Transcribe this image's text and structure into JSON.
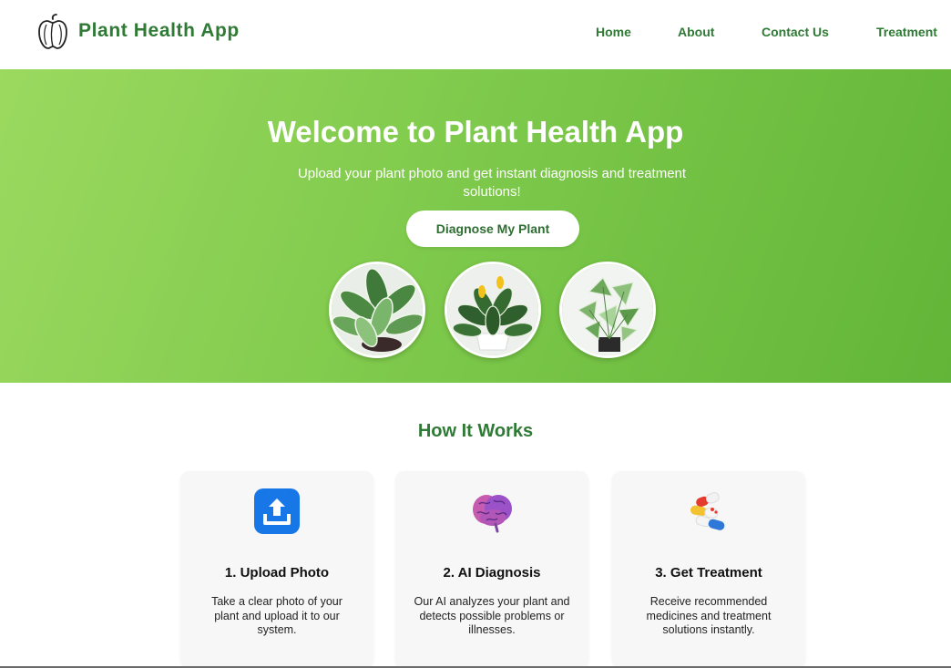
{
  "header": {
    "brand": "Plant Health App",
    "logo_icon": "bell-pepper-icon",
    "nav": [
      {
        "label": "Home"
      },
      {
        "label": "About"
      },
      {
        "label": "Contact Us"
      },
      {
        "label": "Treatment"
      }
    ]
  },
  "hero": {
    "title": "Welcome to Plant Health App",
    "subtitle": "Upload your plant photo and get instant diagnosis and treatment solutions!",
    "cta_label": "Diagnose My Plant",
    "images": [
      "dieffenbachia-plant-photo",
      "zebra-plant-photo",
      "syngonium-plant-photo"
    ]
  },
  "how_it_works": {
    "title": "How It Works",
    "steps": [
      {
        "icon": "upload-icon",
        "title": "1. Upload Photo",
        "text": "Take a clear photo of your plant and upload it to our system."
      },
      {
        "icon": "brain-icon",
        "title": "2. AI Diagnosis",
        "text": "Our AI analyzes your plant and detects possible problems or illnesses."
      },
      {
        "icon": "pills-icon",
        "title": "3. Get Treatment",
        "text": "Receive recommended medicines and treatment solutions instantly."
      }
    ]
  },
  "colors": {
    "brand_green": "#2f7a35",
    "hero_gradient_start": "#9bd95f",
    "hero_gradient_end": "#62b538",
    "upload_blue": "#1877e6"
  }
}
